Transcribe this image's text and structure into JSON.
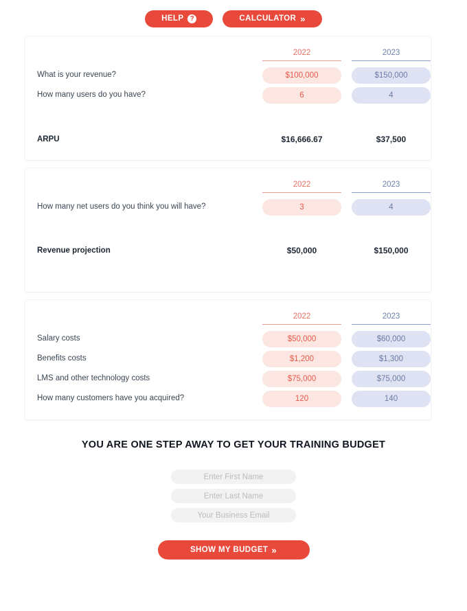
{
  "toolbar": {
    "help_label": "HELP",
    "help_icon": "question-circle-icon",
    "calculator_label": "CALCULATOR",
    "calculator_icon": "double-chevron-right-icon"
  },
  "colors": {
    "brand_red": "#e8493a",
    "year_2022_text": "#e8715f",
    "year_2022_pill_bg": "#fbe6e1",
    "year_2022_pill_text": "#e8594a",
    "year_2023_text": "#6e7fa8",
    "year_2023_pill_bg": "#dfe2f2",
    "year_2023_pill_text": "#6b7ba6",
    "label_text": "#3a4653",
    "summary_text": "#1d2733"
  },
  "columns": [
    "2022",
    "2023"
  ],
  "cards": [
    {
      "id": "arpu-card",
      "rows": [
        {
          "label": "What is your revenue?",
          "values": [
            "$100,000",
            "$150,000"
          ]
        },
        {
          "label": "How many users do you have?",
          "values": [
            "6",
            "4"
          ]
        }
      ],
      "summary": {
        "label": "ARPU",
        "values": [
          "$16,666.67",
          "$37,500"
        ]
      }
    },
    {
      "id": "revenue-projection-card",
      "rows": [
        {
          "label": "How many net users do you think you will have?",
          "values": [
            "3",
            "4"
          ]
        }
      ],
      "summary": {
        "label": "Revenue projection",
        "values": [
          "$50,000",
          "$150,000"
        ]
      }
    },
    {
      "id": "costs-card",
      "rows": [
        {
          "label": "Salary costs",
          "values": [
            "$50,000",
            "$60,000"
          ]
        },
        {
          "label": "Benefits costs",
          "values": [
            "$1,200",
            "$1,300"
          ]
        },
        {
          "label": "LMS and other technology costs",
          "values": [
            "$75,000",
            "$75,000"
          ]
        },
        {
          "label": "How many customers have you acquired?",
          "values": [
            "120",
            "140"
          ]
        }
      ],
      "summary": null
    }
  ],
  "form": {
    "title": "YOU ARE ONE STEP AWAY TO GET YOUR TRAINING BUDGET",
    "first_name_placeholder": "Enter First Name",
    "first_name_value": "",
    "last_name_placeholder": "Enter Last Name",
    "last_name_value": "",
    "email_placeholder": "Your Business Email",
    "email_value": "",
    "submit_label": "SHOW MY BUDGET",
    "submit_icon": "double-chevron-right-icon"
  }
}
